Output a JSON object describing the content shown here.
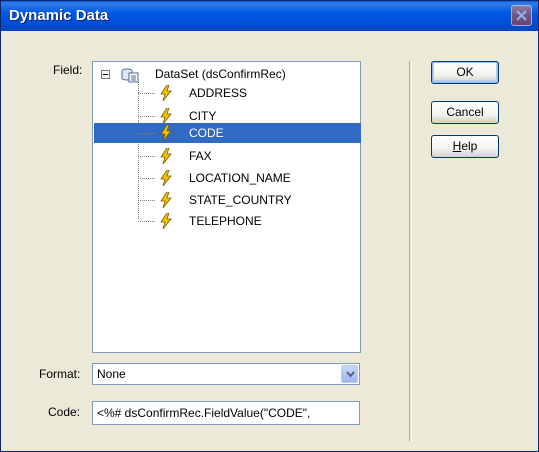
{
  "window": {
    "title": "Dynamic Data"
  },
  "field": {
    "label": "Field:",
    "tree": {
      "root_label": "DataSet (dsConfirmRec)",
      "items": [
        {
          "label": "ADDRESS",
          "selected": false
        },
        {
          "label": "CITY",
          "selected": false
        },
        {
          "label": "CODE",
          "selected": true
        },
        {
          "label": "FAX",
          "selected": false
        },
        {
          "label": "LOCATION_NAME",
          "selected": false
        },
        {
          "label": "STATE_COUNTRY",
          "selected": false
        },
        {
          "label": "TELEPHONE",
          "selected": false
        }
      ]
    }
  },
  "format": {
    "label": "Format:",
    "value": "None"
  },
  "code": {
    "label": "Code:",
    "value": "<%# dsConfirmRec.FieldValue(\"CODE\","
  },
  "buttons": {
    "ok": "OK",
    "cancel": "Cancel",
    "help_mnemonic": "H",
    "help_rest": "elp"
  },
  "colors": {
    "title_bar": "#0058e6",
    "selection": "#316ac5",
    "dialog_bg": "#ece9d8"
  },
  "icons": {
    "close": "close-icon",
    "dataset": "dataset-icon",
    "field": "lightning-bolt-icon",
    "expander": "collapse-minus-icon",
    "dropdown": "chevron-down-icon"
  }
}
